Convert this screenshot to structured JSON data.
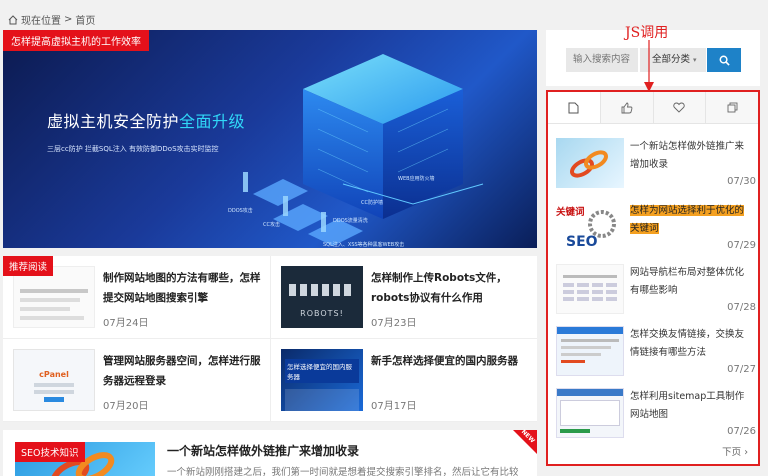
{
  "breadcrumb": {
    "label": "现在位置",
    "sep": ">",
    "current": "首页"
  },
  "hero": {
    "tag": "怎样提高虚拟主机的工作效率",
    "title_main": "虚拟主机安全防护",
    "title_hl": "全面升级",
    "subtitle": "三层cc防护  拦截SQL注入  有效防御DDoS攻击实时监控",
    "labels": [
      "WEB应用防火墙",
      "CC防护墙",
      "DDOS流量清洗",
      "DDOS攻击",
      "CC攻击",
      "SQL注入、XSS等各种黑客WEB攻击"
    ]
  },
  "cards": [
    {
      "tag": "推荐阅读",
      "title": "制作网站地图的方法有哪些，怎样提交网站地图搜索引擎",
      "date": "07月24日"
    },
    {
      "tag": "",
      "title": "怎样制作上传Robots文件，robots协议有什么作用",
      "date": "07月23日",
      "thumb_text": "ROBOTS!"
    },
    {
      "tag": "",
      "title": "管理网站服务器空间，怎样进行服务器远程登录",
      "date": "07月20日",
      "thumb_text": "cPanel"
    },
    {
      "tag": "",
      "title": "新手怎样选择便宜的国内服务器",
      "date": "07月17日",
      "thumb_text": "怎样选择便宜的国内服务器"
    }
  ],
  "article": {
    "tag": "SEO技术知识",
    "title": "一个新站怎样做外链推广来增加收录",
    "desc": "一个新站刚刚搭建之后，我们第一时间就是想着提交搜索引擎排名，然后让它有比较",
    "badge": "NEW"
  },
  "search": {
    "placeholder": "输入搜索内容",
    "category": "全部分类",
    "category_arrow": "▾"
  },
  "annotation": {
    "label": "JS调用"
  },
  "sidebar": {
    "tabs": [
      "document-icon",
      "thumb-up-icon",
      "heart-icon",
      "copy-icon"
    ],
    "items": [
      {
        "title": "一个新站怎样做外链推广来增加收录",
        "date": "07/30",
        "highlight": false
      },
      {
        "title": "怎样为网站选择利于优化的关键词",
        "date": "07/29",
        "highlight": true,
        "thumb_text": "关键词"
      },
      {
        "title": "网站导航栏布局对整体优化有哪些影响",
        "date": "07/28",
        "highlight": false
      },
      {
        "title": "怎样交换友情链接，交换友情链接有哪些方法",
        "date": "07/27",
        "highlight": false
      },
      {
        "title": "怎样利用sitemap工具制作网站地图",
        "date": "07/26",
        "highlight": false
      }
    ],
    "next": "下页",
    "next_arrow": "›"
  },
  "colors": {
    "accent_red": "#e4111a",
    "search_blue": "#1e82c8",
    "annotation_red": "#e02020"
  }
}
